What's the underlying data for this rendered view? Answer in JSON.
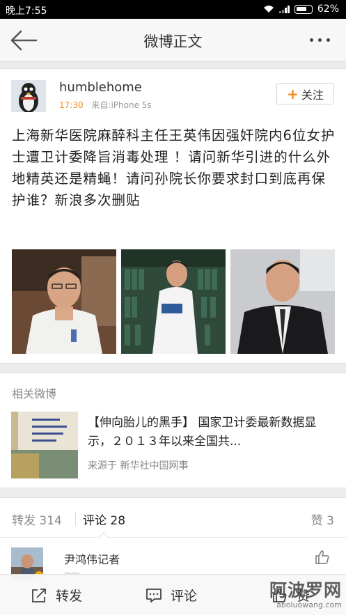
{
  "status_bar": {
    "time": "晚上7:55",
    "battery": "62%"
  },
  "nav": {
    "title": "微博正文",
    "back_icon": "back-arrow-icon",
    "more_icon": "more-dots-icon"
  },
  "post": {
    "username": "humblehome",
    "time": "17:30",
    "source": "来自:iPhone 5s",
    "follow_label": "关注",
    "follow_icon": "plus-icon",
    "text": "上海新华医院麻醉科主任王英伟因强奸院内6位女护士遭卫计委降旨消毒处理 ！请问新华引进的什么外地精英还是精蝇！请问孙院长你要求封口到底再保护谁？新浪多次删贴",
    "photos": [
      "photo-doctor-white-coat",
      "photo-doctor-library",
      "photo-man-black-suit"
    ]
  },
  "related": {
    "heading": "相关微博",
    "title": "【伸向胎儿的黑手】 国家卫计委最新数据显示，２０１３年以来全国共...",
    "source": "来源于 新华社中国网事"
  },
  "tabs": {
    "repost": "转发 314",
    "comment": "评论 28",
    "like": "赞 3"
  },
  "comment": {
    "name": "尹鸿伟记者",
    "time": "刚刚",
    "like_icon": "thumbs-up-icon"
  },
  "bottom_bar": {
    "repost_label": "转发",
    "comment_label": "评论",
    "like_label": "赞"
  },
  "watermark": {
    "cn": "阿波罗网",
    "en": "aboluowang.com"
  },
  "colors": {
    "accent_orange": "#f28a1a",
    "background": "#ececec"
  }
}
